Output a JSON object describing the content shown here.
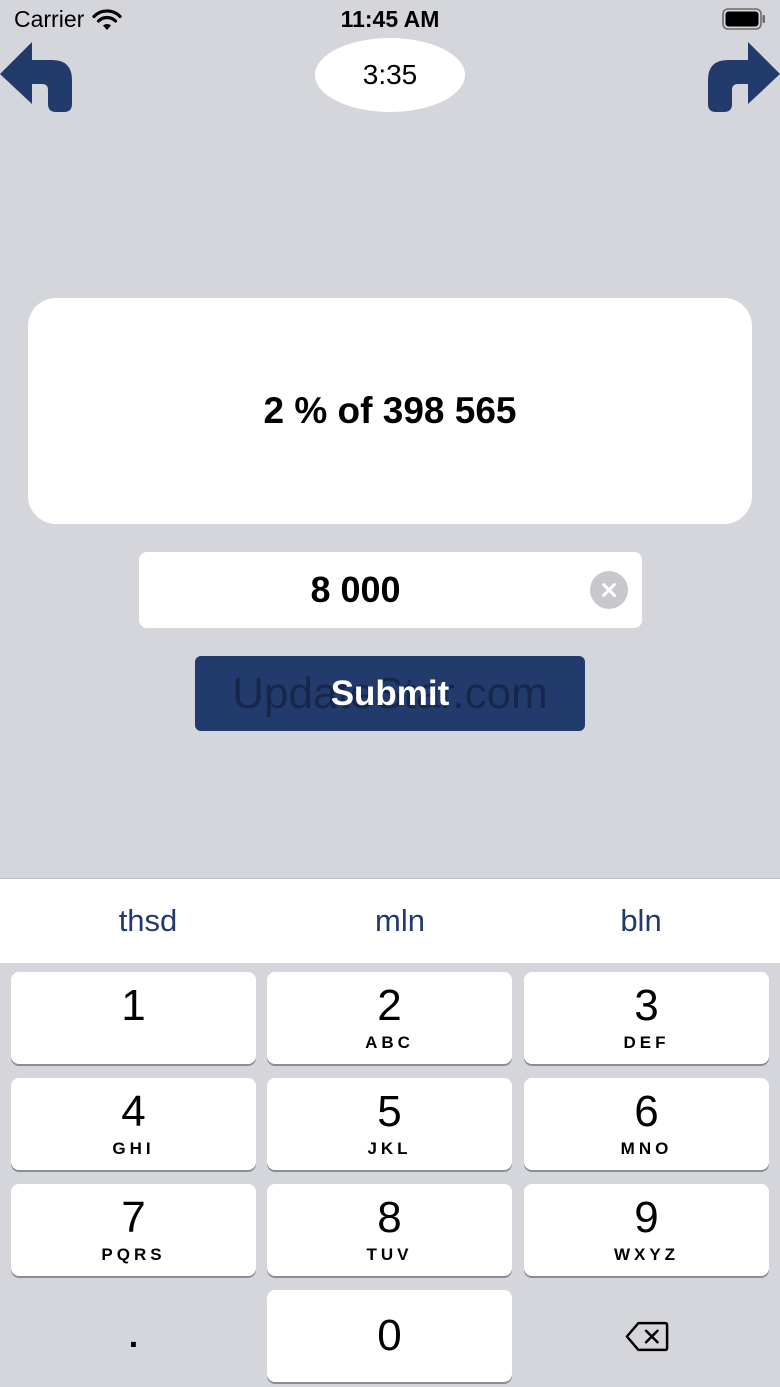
{
  "status_bar": {
    "carrier": "Carrier",
    "time": "11:45 AM"
  },
  "timer": "3:35",
  "question": "2 % of 398 565",
  "answer": {
    "value": "8 000"
  },
  "submit_label": "Submit",
  "watermark": "UpdateStar.com",
  "suggestions": [
    "thsd",
    "mln",
    "bln"
  ],
  "keypad": [
    {
      "digit": "1",
      "letters": ""
    },
    {
      "digit": "2",
      "letters": "ABC"
    },
    {
      "digit": "3",
      "letters": "DEF"
    },
    {
      "digit": "4",
      "letters": "GHI"
    },
    {
      "digit": "5",
      "letters": "JKL"
    },
    {
      "digit": "6",
      "letters": "MNO"
    },
    {
      "digit": "7",
      "letters": "PQRS"
    },
    {
      "digit": "8",
      "letters": "TUV"
    },
    {
      "digit": "9",
      "letters": "WXYZ"
    },
    {
      "digit": "0",
      "letters": ""
    }
  ],
  "decimal_key": ".",
  "colors": {
    "accent": "#233a6d",
    "background": "#d4d6db",
    "card": "#ffffff"
  },
  "icons": {
    "back": "undo-arrow-icon",
    "forward": "redo-arrow-icon",
    "clear": "clear-circle-icon",
    "delete": "backspace-icon"
  }
}
